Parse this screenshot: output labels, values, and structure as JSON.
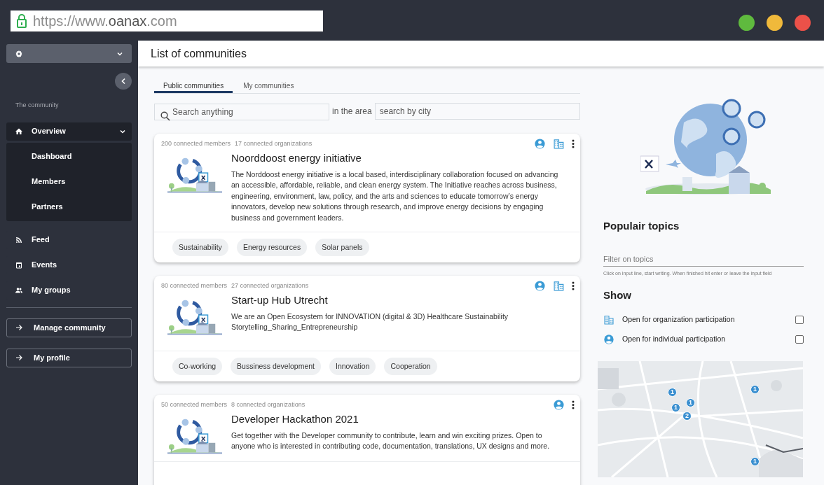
{
  "browser": {
    "url_prefix": "https://www.",
    "url_domain": "oanax",
    "url_suffix": ".com"
  },
  "sidebar": {
    "section_title": "The community",
    "items": [
      {
        "label": "Overview",
        "selected": true,
        "expanded": true,
        "children": [
          {
            "label": "Dashboard"
          },
          {
            "label": "Members"
          },
          {
            "label": "Partners"
          }
        ]
      },
      {
        "label": "Feed",
        "selected": false
      },
      {
        "label": "Events",
        "selected": false
      },
      {
        "label": "My groups",
        "selected": false
      }
    ],
    "buttons": [
      "Manage community",
      "My profile"
    ]
  },
  "page_title": "List of communities",
  "tabs": [
    {
      "label": "Public communities",
      "selected": true
    },
    {
      "label": "My communities",
      "selected": false
    }
  ],
  "search": {
    "placeholder": "Search anything",
    "area_label": "in the area",
    "city_placeholder": "search by city"
  },
  "communities": [
    {
      "members": "200 connected members",
      "organizations": "17 connected organizations",
      "open_individual": true,
      "open_organization": true,
      "title": "Noorddoost energy initiative",
      "description": "The Norddoost energy initiative is a local based, interdisciplinary collaboration focused on advancing an accessible, affordable, reliable, and clean energy system. The Initiative reaches across business, engineering, environment, law, policy, and the arts and sciences to educate tomorrow’s energy innovators, develop new solutions through research, and improve energy decisions by engaging business and government leaders.",
      "tags": [
        "Sustainability",
        "Energy resources",
        "Solar panels"
      ]
    },
    {
      "members": "80 connected members",
      "organizations": "27 connected organizations",
      "open_individual": true,
      "open_organization": true,
      "title": "Start-up Hub Utrecht",
      "description": "We are an Open Ecosystem for INNOVATION (digital & 3D) Healthcare Sustainability Storytelling_Sharing_Entrepreneurship",
      "tags": [
        "Co-working",
        "Bussiness development",
        "Innovation",
        "Cooperation"
      ]
    },
    {
      "members": "50 connected members",
      "organizations": "8 connected organizations",
      "open_individual": true,
      "open_organization": false,
      "title": "Developer Hackathon 2021",
      "description": "Get together with the Developer community to contribute, learn and win exciting prizes. Open to anyone who is interested in contributing code, documentation, translations, UX designs and more."
    }
  ],
  "topics": {
    "title": "Populair topics",
    "placeholder": "Filter on topics",
    "hint": "Click on input line, start writing. When finished hit enter or leave the input field"
  },
  "show": {
    "title": "Show",
    "options": [
      {
        "kind": "organization",
        "label": "Open for organization participation",
        "checked": false
      },
      {
        "kind": "individual",
        "label": "Open for individual participation",
        "checked": false
      }
    ]
  },
  "map": {
    "pins": [
      "1",
      "1",
      "1",
      "2",
      "1",
      "1"
    ]
  }
}
